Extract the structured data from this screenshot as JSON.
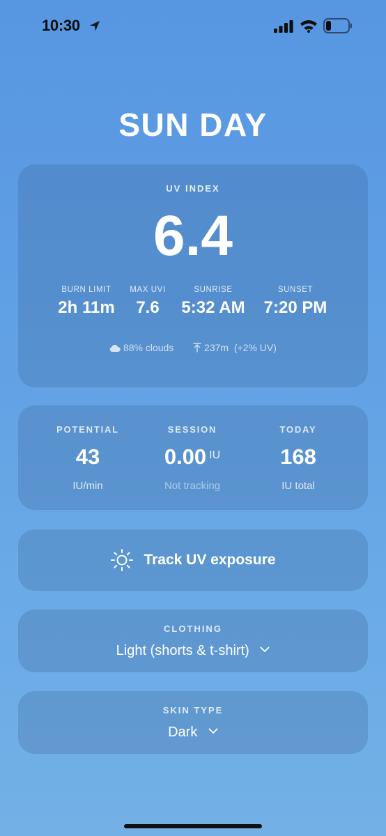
{
  "status_bar": {
    "time": "10:30"
  },
  "app": {
    "title": "SUN DAY"
  },
  "uv_card": {
    "label": "UV INDEX",
    "value": "6.4",
    "stats": [
      {
        "label": "BURN LIMIT",
        "value": "2h 11m"
      },
      {
        "label": "MAX UVI",
        "value": "7.6"
      },
      {
        "label": "SUNRISE",
        "value": "5:32 AM"
      },
      {
        "label": "SUNSET",
        "value": "7:20 PM"
      }
    ],
    "clouds": "88% clouds",
    "altitude": "237m  (+2% UV)"
  },
  "vitamin_card": {
    "columns": [
      {
        "label": "POTENTIAL",
        "value": "43",
        "unit": "",
        "sub": "IU/min"
      },
      {
        "label": "SESSION",
        "value": "0.00",
        "unit": "IU",
        "sub": "Not tracking"
      },
      {
        "label": "TODAY",
        "value": "168",
        "unit": "",
        "sub": "IU total"
      }
    ]
  },
  "track": {
    "label": "Track UV exposure"
  },
  "clothing": {
    "label": "CLOTHING",
    "value": "Light (shorts & t-shirt)"
  },
  "skin_type": {
    "label": "SKIN TYPE",
    "value": "Dark"
  },
  "icons": {
    "location": "location-arrow-icon",
    "signal": "cellular-signal-icon",
    "wifi": "wifi-icon",
    "battery": "battery-icon",
    "cloud": "cloud-icon",
    "altitude": "altitude-arrow-icon",
    "sun": "sun-icon",
    "chevron": "chevron-down-icon"
  }
}
